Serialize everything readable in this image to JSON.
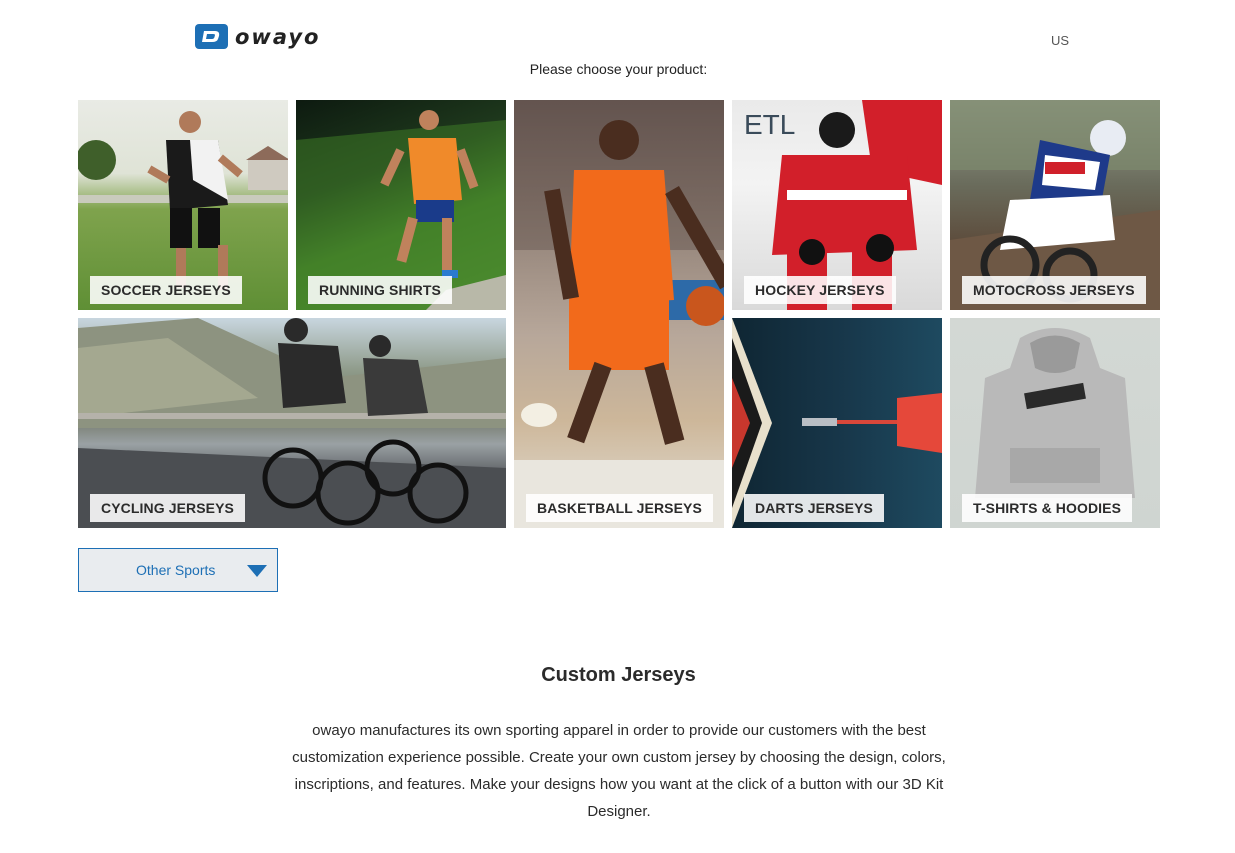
{
  "header": {
    "logo_text": "owayo",
    "region": "US"
  },
  "prompt": "Please choose your product:",
  "products": [
    {
      "label": "SOCCER JERSEYS"
    },
    {
      "label": "RUNNING SHIRTS"
    },
    {
      "label": "BASKETBALL JERSEYS"
    },
    {
      "label": "HOCKEY JERSEYS"
    },
    {
      "label": "MOTOCROSS JERSEYS"
    },
    {
      "label": "CYCLING JERSEYS"
    },
    {
      "label": "DARTS JERSEYS"
    },
    {
      "label": "T-SHIRTS & HOODIES"
    }
  ],
  "other_sports": {
    "label": "Other Sports",
    "icon": "triangle-down-icon"
  },
  "section": {
    "title": "Custom Jerseys",
    "body": "owayo manufactures its own sporting apparel in order to provide our customers with the best customization experience possible. Create your own custom jersey by choosing the design, colors, inscriptions, and features. Make your designs how you want at the click of a button with our 3D Kit Designer."
  },
  "colors": {
    "brand": "#1d6fb5",
    "text": "#2b2b2b",
    "dropdown_bg": "#e9ecef"
  }
}
